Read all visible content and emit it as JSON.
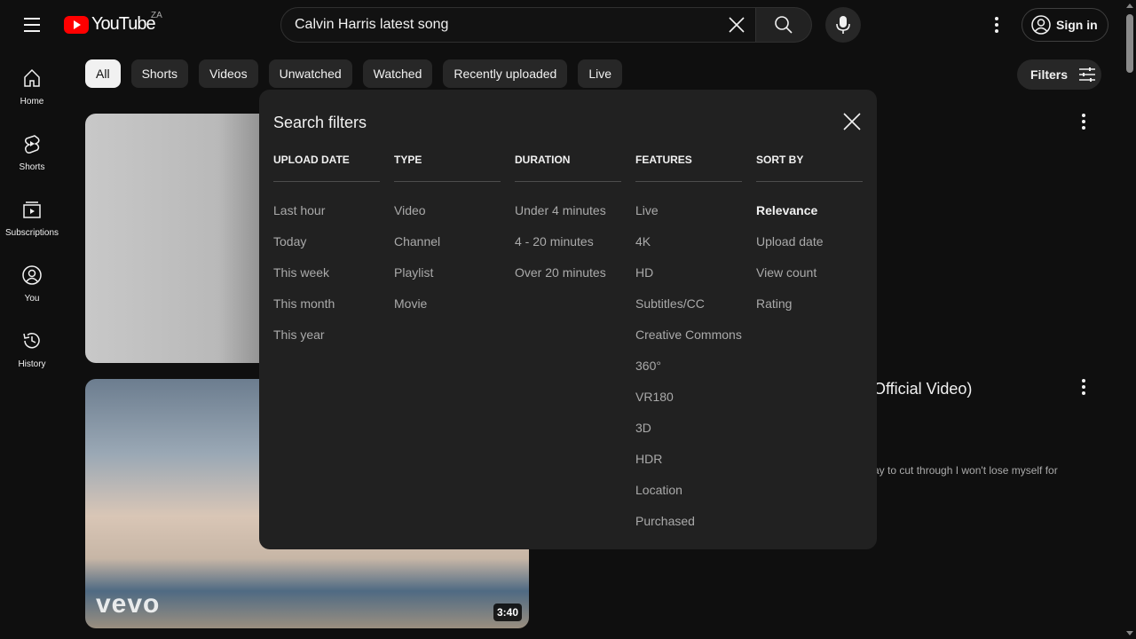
{
  "header": {
    "logo_text": "YouTube",
    "country_code": "ZA",
    "search_value": "Calvin Harris latest song",
    "sign_in_label": "Sign in"
  },
  "guide": {
    "items": [
      {
        "label": "Home",
        "icon": "home-icon"
      },
      {
        "label": "Shorts",
        "icon": "shorts-icon"
      },
      {
        "label": "Subscriptions",
        "icon": "subscriptions-icon"
      },
      {
        "label": "You",
        "icon": "you-icon"
      },
      {
        "label": "History",
        "icon": "history-icon"
      }
    ]
  },
  "chips": {
    "items": [
      "All",
      "Shorts",
      "Videos",
      "Unwatched",
      "Watched",
      "Recently uploaded",
      "Live"
    ],
    "active": "All",
    "filters_label": "Filters"
  },
  "results": [
    {
      "duration": "",
      "title": "",
      "description": ""
    },
    {
      "duration": "3:40",
      "title": "Official Video)",
      "description": "ay to cut through I won't lose myself for",
      "badge": "vevo"
    }
  ],
  "dialog": {
    "title": "Search filters",
    "columns": [
      {
        "heading": "UPLOAD DATE",
        "options": [
          "Last hour",
          "Today",
          "This week",
          "This month",
          "This year"
        ]
      },
      {
        "heading": "TYPE",
        "options": [
          "Video",
          "Channel",
          "Playlist",
          "Movie"
        ]
      },
      {
        "heading": "DURATION",
        "options": [
          "Under 4 minutes",
          "4 - 20 minutes",
          "Over 20 minutes"
        ]
      },
      {
        "heading": "FEATURES",
        "options": [
          "Live",
          "4K",
          "HD",
          "Subtitles/CC",
          "Creative Commons",
          "360°",
          "VR180",
          "3D",
          "HDR",
          "Location",
          "Purchased"
        ]
      },
      {
        "heading": "SORT BY",
        "options": [
          "Relevance",
          "Upload date",
          "View count",
          "Rating"
        ],
        "selected": "Relevance"
      }
    ]
  },
  "colors": {
    "background": "#0f0f0f",
    "dialog": "#212121",
    "chip": "#272727",
    "brand_red": "#ff0000"
  }
}
